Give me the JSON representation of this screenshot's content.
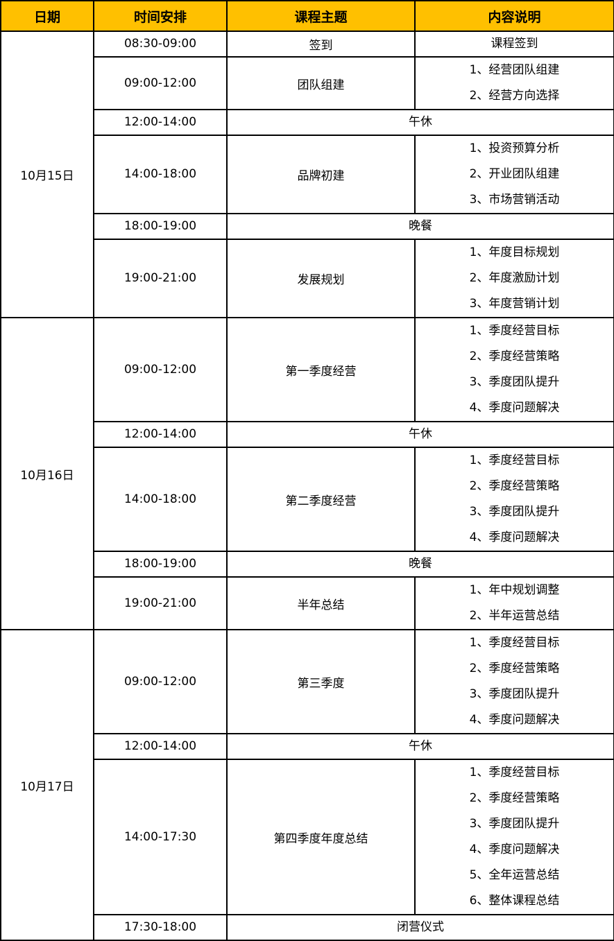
{
  "header": {
    "date": "日期",
    "time": "时间安排",
    "topic": "课程主题",
    "content": "内容说明"
  },
  "colors": {
    "header_bg": "#FFC000",
    "border": "#000000"
  },
  "days": [
    {
      "date": "10月15日",
      "sessions": [
        {
          "time": "08:30-09:00",
          "topic": "签到",
          "content": [
            "课程签到"
          ]
        },
        {
          "time": "09:00-12:00",
          "topic": "团队组建",
          "content": [
            "1、经营团队组建",
            "2、经营方向选择"
          ]
        },
        {
          "time": "12:00-14:00",
          "break": "午休"
        },
        {
          "time": "14:00-18:00",
          "topic": "品牌初建",
          "content": [
            "1、投资预算分析",
            "2、开业团队组建",
            "3、市场营销活动"
          ]
        },
        {
          "time": "18:00-19:00",
          "break": "晚餐"
        },
        {
          "time": "19:00-21:00",
          "topic": "发展规划",
          "content": [
            "1、年度目标规划",
            "2、年度激励计划",
            "3、年度营销计划"
          ]
        }
      ]
    },
    {
      "date": "10月16日",
      "sessions": [
        {
          "time": "09:00-12:00",
          "topic": "第一季度经营",
          "content": [
            "1、季度经营目标",
            "2、季度经营策略",
            "3、季度团队提升",
            "4、季度问题解决"
          ]
        },
        {
          "time": "12:00-14:00",
          "break": "午休"
        },
        {
          "time": "14:00-18:00",
          "topic": "第二季度经营",
          "content": [
            "1、季度经营目标",
            "2、季度经营策略",
            "3、季度团队提升",
            "4、季度问题解决"
          ]
        },
        {
          "time": "18:00-19:00",
          "break": "晚餐"
        },
        {
          "time": "19:00-21:00",
          "topic": "半年总结",
          "content": [
            "1、年中规划调整",
            "2、半年运营总结"
          ]
        }
      ]
    },
    {
      "date": "10月17日",
      "sessions": [
        {
          "time": "09:00-12:00",
          "topic": "第三季度",
          "content": [
            "1、季度经营目标",
            "2、季度经营策略",
            "3、季度团队提升",
            "4、季度问题解决"
          ]
        },
        {
          "time": "12:00-14:00",
          "break": "午休"
        },
        {
          "time": "14:00-17:30",
          "topic": "第四季度年度总结",
          "content": [
            "1、季度经营目标",
            "2、季度经营策略",
            "3、季度团队提升",
            "4、季度问题解决",
            "5、全年运营总结",
            "6、整体课程总结"
          ]
        },
        {
          "time": "17:30-18:00",
          "break": "闭营仪式"
        }
      ]
    }
  ]
}
